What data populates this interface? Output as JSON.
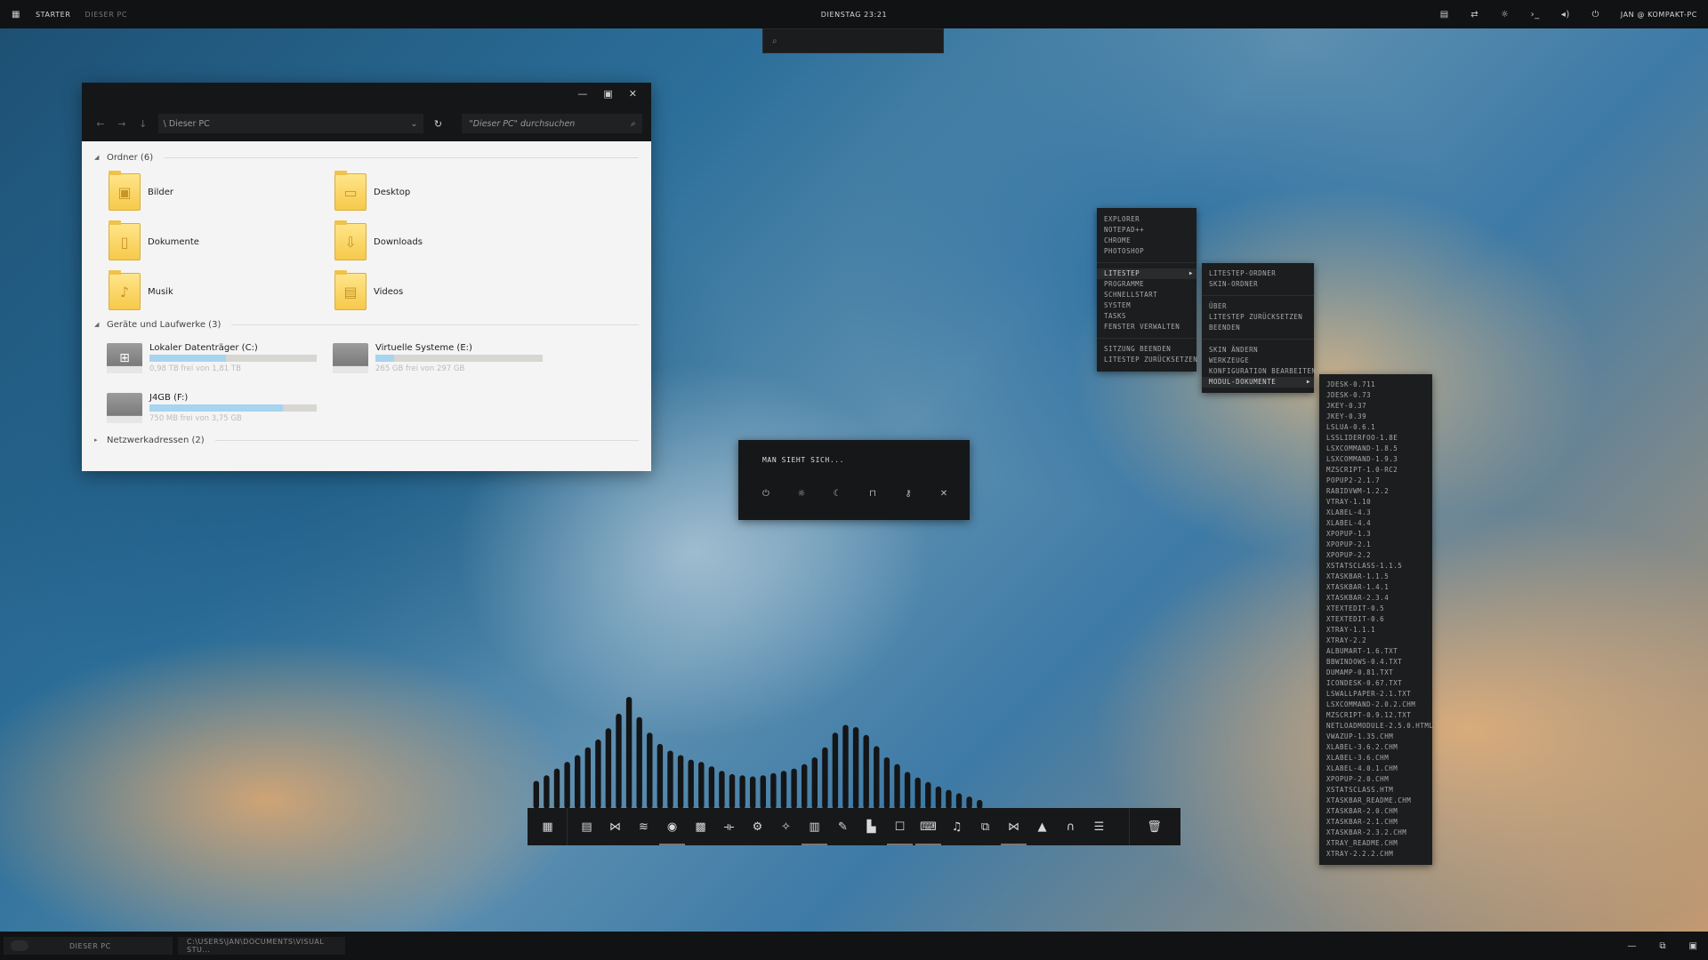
{
  "topbar": {
    "starter": "STARTER",
    "location": "DIESER PC",
    "clock": "DIENSTAG 23:21",
    "user": "JAN @ KOMPAKT-PC",
    "tray_icons": [
      "calendar-icon",
      "network-icon",
      "brightness-icon",
      "terminal-icon",
      "volume-icon",
      "power-icon"
    ]
  },
  "search": {
    "icon": "search-icon",
    "placeholder": ""
  },
  "explorer": {
    "address": "\\ Dieser PC",
    "search_placeholder": "\"Dieser PC\" durchsuchen",
    "groups": {
      "folders_title": "Ordner (6)",
      "drives_title": "Geräte und Laufwerke (3)",
      "network_title": "Netzwerkadressen (2)"
    },
    "folders": [
      {
        "name": "Bilder",
        "icon": "picture-icon"
      },
      {
        "name": "Desktop",
        "icon": "desktop-icon"
      },
      {
        "name": "Dokumente",
        "icon": "document-icon"
      },
      {
        "name": "Downloads",
        "icon": "download-icon"
      },
      {
        "name": "Musik",
        "icon": "music-icon"
      },
      {
        "name": "Videos",
        "icon": "video-icon"
      }
    ],
    "drives": [
      {
        "name": "Lokaler Datenträger (C:)",
        "free": "0,98 TB frei von 1,81 TB",
        "used_fraction": 0.46
      },
      {
        "name": "Virtuelle Systeme (E:)",
        "free": "265 GB frei von 297 GB",
        "used_fraction": 0.11
      },
      {
        "name": "J4GB (F:)",
        "free": "750 MB frei von 3,75 GB",
        "used_fraction": 0.8
      }
    ]
  },
  "menus": {
    "main_a": [
      "EXPLORER",
      "NOTEPAD++",
      "CHROME",
      "PHOTOSHOP"
    ],
    "main_b": [
      "LITESTEP",
      "PROGRAMME",
      "SCHNELLSTART",
      "SYSTEM",
      "TASKS",
      "FENSTER VERWALTEN"
    ],
    "main_c": [
      "SITZUNG BEENDEN",
      "LITESTEP ZURÜCKSETZEN"
    ],
    "sub_a": [
      "LITESTEP-ORDNER",
      "SKIN-ORDNER"
    ],
    "sub_b": [
      "ÜBER",
      "LITESTEP ZURÜCKSETZEN",
      "BEENDEN"
    ],
    "sub_c": [
      "SKIN ÄNDERN",
      "WERKZEUGE",
      "KONFIGURATION BEARBEITEN",
      "MODUL-DOKUMENTE"
    ],
    "modules": [
      "JDESK-0.711",
      "JDESK-0.73",
      "JKEY-0.37",
      "JKEY-0.39",
      "LSLUA-0.6.1",
      "LSSLIDERFOO-1.8E",
      "LSXCOMMAND-1.8.5",
      "LSXCOMMAND-1.9.3",
      "MZSCRIPT-1.0-RC2",
      "POPUP2-2.1.7",
      "RABIDVWM-1.2.2",
      "VTRAY-1.10",
      "XLABEL-4.3",
      "XLABEL-4.4",
      "XPOPUP-1.3",
      "XPOPUP-2.1",
      "XPOPUP-2.2",
      "XSTATSCLASS-1.1.5",
      "XTASKBAR-1.1.5",
      "XTASKBAR-1.4.1",
      "XTASKBAR-2.3.4",
      "XTEXTEDIT-0.5",
      "XTEXTEDIT-0.6",
      "XTRAY-1.1.1",
      "XTRAY-2.2",
      "ALBUMART-1.6.TXT",
      "BBWINDOWS-0.4.TXT",
      "DUMAMP-0.81.TXT",
      "ICONDESK-0.67.TXT",
      "LSWALLPAPER-2.1.TXT",
      "LSXCOMMAND-2.0.2.CHM",
      "MZSCRIPT-0.9.12.TXT",
      "NETLOADMODULE-2.5.0.HTML",
      "VWAZUP-1.35.CHM",
      "XLABEL-3.6.2.CHM",
      "XLABEL-3.6.CHM",
      "XLABEL-4.0.1.CHM",
      "XPOPUP-2.0.CHM",
      "XSTATSCLASS.HTM",
      "XTASKBAR_README.CHM",
      "XTASKBAR-2.0.CHM",
      "XTASKBAR-2.1.CHM",
      "XTASKBAR-2.3.2.CHM",
      "XTRAY_README.CHM",
      "XTRAY-2.2.2.CHM"
    ]
  },
  "logout": {
    "message": "MAN SIEHT SICH...",
    "buttons": [
      "power-icon",
      "sleep-icon",
      "moon-icon",
      "lock-icon",
      "key-icon",
      "close-icon"
    ]
  },
  "visualizer_levels": [
    0.25,
    0.3,
    0.36,
    0.42,
    0.48,
    0.55,
    0.62,
    0.72,
    0.85,
    1.0,
    0.82,
    0.68,
    0.58,
    0.52,
    0.48,
    0.44,
    0.42,
    0.38,
    0.34,
    0.31,
    0.3,
    0.29,
    0.3,
    0.32,
    0.34,
    0.36,
    0.4,
    0.46,
    0.55,
    0.68,
    0.75,
    0.73,
    0.66,
    0.56,
    0.46,
    0.4,
    0.33,
    0.28,
    0.24,
    0.2,
    0.17,
    0.14,
    0.11,
    0.08
  ],
  "dock": {
    "icons": [
      "app-icon",
      "notes-icon",
      "media-icon",
      "lines-icon",
      "chrome-icon",
      "grid-icon",
      "sound-icon",
      "steam-icon",
      "magic-icon",
      "document-icon",
      "feather-icon",
      "chart-icon",
      "chat-icon",
      "game-icon",
      "mic-icon",
      "layers-icon",
      "media-icon",
      "vlc-icon",
      "headphones-icon",
      "text-icon",
      "trash-icon"
    ],
    "running": [
      4,
      11,
      13,
      17
    ]
  },
  "taskbar": {
    "tasks": [
      "DIESER PC",
      "C:\\USERS\\JAN\\DOCUMENTS\\VISUAL STU..."
    ],
    "right_icons": [
      "minimize-icon",
      "restore-icon",
      "maximize-icon"
    ]
  }
}
